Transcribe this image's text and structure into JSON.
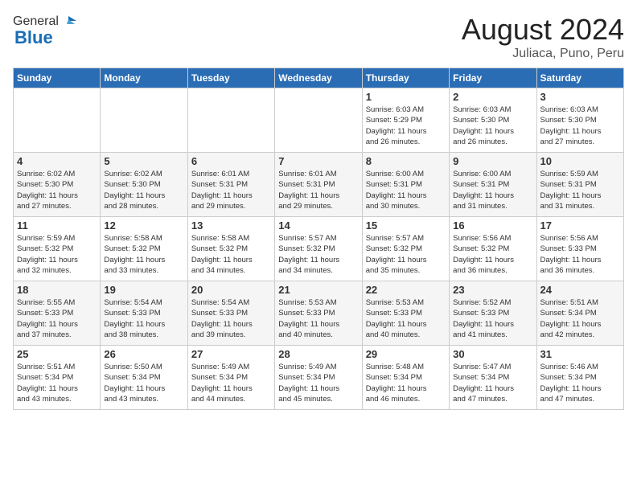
{
  "header": {
    "logo_general": "General",
    "logo_blue": "Blue",
    "month_year": "August 2024",
    "location": "Juliaca, Puno, Peru"
  },
  "weekdays": [
    "Sunday",
    "Monday",
    "Tuesday",
    "Wednesday",
    "Thursday",
    "Friday",
    "Saturday"
  ],
  "weeks": [
    [
      {
        "day": "",
        "info": ""
      },
      {
        "day": "",
        "info": ""
      },
      {
        "day": "",
        "info": ""
      },
      {
        "day": "",
        "info": ""
      },
      {
        "day": "1",
        "info": "Sunrise: 6:03 AM\nSunset: 5:29 PM\nDaylight: 11 hours\nand 26 minutes."
      },
      {
        "day": "2",
        "info": "Sunrise: 6:03 AM\nSunset: 5:30 PM\nDaylight: 11 hours\nand 26 minutes."
      },
      {
        "day": "3",
        "info": "Sunrise: 6:03 AM\nSunset: 5:30 PM\nDaylight: 11 hours\nand 27 minutes."
      }
    ],
    [
      {
        "day": "4",
        "info": "Sunrise: 6:02 AM\nSunset: 5:30 PM\nDaylight: 11 hours\nand 27 minutes."
      },
      {
        "day": "5",
        "info": "Sunrise: 6:02 AM\nSunset: 5:30 PM\nDaylight: 11 hours\nand 28 minutes."
      },
      {
        "day": "6",
        "info": "Sunrise: 6:01 AM\nSunset: 5:31 PM\nDaylight: 11 hours\nand 29 minutes."
      },
      {
        "day": "7",
        "info": "Sunrise: 6:01 AM\nSunset: 5:31 PM\nDaylight: 11 hours\nand 29 minutes."
      },
      {
        "day": "8",
        "info": "Sunrise: 6:00 AM\nSunset: 5:31 PM\nDaylight: 11 hours\nand 30 minutes."
      },
      {
        "day": "9",
        "info": "Sunrise: 6:00 AM\nSunset: 5:31 PM\nDaylight: 11 hours\nand 31 minutes."
      },
      {
        "day": "10",
        "info": "Sunrise: 5:59 AM\nSunset: 5:31 PM\nDaylight: 11 hours\nand 31 minutes."
      }
    ],
    [
      {
        "day": "11",
        "info": "Sunrise: 5:59 AM\nSunset: 5:32 PM\nDaylight: 11 hours\nand 32 minutes."
      },
      {
        "day": "12",
        "info": "Sunrise: 5:58 AM\nSunset: 5:32 PM\nDaylight: 11 hours\nand 33 minutes."
      },
      {
        "day": "13",
        "info": "Sunrise: 5:58 AM\nSunset: 5:32 PM\nDaylight: 11 hours\nand 34 minutes."
      },
      {
        "day": "14",
        "info": "Sunrise: 5:57 AM\nSunset: 5:32 PM\nDaylight: 11 hours\nand 34 minutes."
      },
      {
        "day": "15",
        "info": "Sunrise: 5:57 AM\nSunset: 5:32 PM\nDaylight: 11 hours\nand 35 minutes."
      },
      {
        "day": "16",
        "info": "Sunrise: 5:56 AM\nSunset: 5:32 PM\nDaylight: 11 hours\nand 36 minutes."
      },
      {
        "day": "17",
        "info": "Sunrise: 5:56 AM\nSunset: 5:33 PM\nDaylight: 11 hours\nand 36 minutes."
      }
    ],
    [
      {
        "day": "18",
        "info": "Sunrise: 5:55 AM\nSunset: 5:33 PM\nDaylight: 11 hours\nand 37 minutes."
      },
      {
        "day": "19",
        "info": "Sunrise: 5:54 AM\nSunset: 5:33 PM\nDaylight: 11 hours\nand 38 minutes."
      },
      {
        "day": "20",
        "info": "Sunrise: 5:54 AM\nSunset: 5:33 PM\nDaylight: 11 hours\nand 39 minutes."
      },
      {
        "day": "21",
        "info": "Sunrise: 5:53 AM\nSunset: 5:33 PM\nDaylight: 11 hours\nand 40 minutes."
      },
      {
        "day": "22",
        "info": "Sunrise: 5:53 AM\nSunset: 5:33 PM\nDaylight: 11 hours\nand 40 minutes."
      },
      {
        "day": "23",
        "info": "Sunrise: 5:52 AM\nSunset: 5:33 PM\nDaylight: 11 hours\nand 41 minutes."
      },
      {
        "day": "24",
        "info": "Sunrise: 5:51 AM\nSunset: 5:34 PM\nDaylight: 11 hours\nand 42 minutes."
      }
    ],
    [
      {
        "day": "25",
        "info": "Sunrise: 5:51 AM\nSunset: 5:34 PM\nDaylight: 11 hours\nand 43 minutes."
      },
      {
        "day": "26",
        "info": "Sunrise: 5:50 AM\nSunset: 5:34 PM\nDaylight: 11 hours\nand 43 minutes."
      },
      {
        "day": "27",
        "info": "Sunrise: 5:49 AM\nSunset: 5:34 PM\nDaylight: 11 hours\nand 44 minutes."
      },
      {
        "day": "28",
        "info": "Sunrise: 5:49 AM\nSunset: 5:34 PM\nDaylight: 11 hours\nand 45 minutes."
      },
      {
        "day": "29",
        "info": "Sunrise: 5:48 AM\nSunset: 5:34 PM\nDaylight: 11 hours\nand 46 minutes."
      },
      {
        "day": "30",
        "info": "Sunrise: 5:47 AM\nSunset: 5:34 PM\nDaylight: 11 hours\nand 47 minutes."
      },
      {
        "day": "31",
        "info": "Sunrise: 5:46 AM\nSunset: 5:34 PM\nDaylight: 11 hours\nand 47 minutes."
      }
    ]
  ]
}
